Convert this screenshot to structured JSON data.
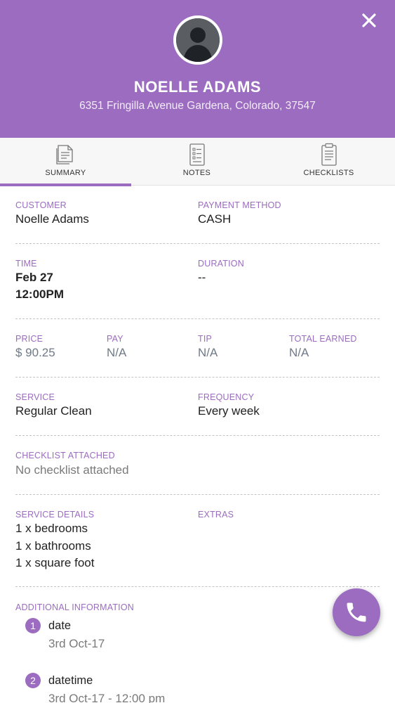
{
  "customer_header": {
    "name": "NOELLE ADAMS",
    "address": "6351 Fringilla Avenue Gardena, Colorado, 37547",
    "close_icon": "close-icon",
    "avatar_icon": "person-silhouette-icon"
  },
  "tabs": [
    {
      "label": "SUMMARY",
      "icon": "document-icon",
      "active": true
    },
    {
      "label": "NOTES",
      "icon": "notes-icon",
      "active": false
    },
    {
      "label": "CHECKLISTS",
      "icon": "clipboard-icon",
      "active": false
    }
  ],
  "summary": {
    "customer": {
      "label": "CUSTOMER",
      "value": "Noelle Adams"
    },
    "payment_method": {
      "label": "PAYMENT METHOD",
      "value": "CASH"
    },
    "time": {
      "label": "TIME",
      "date": "Feb 27",
      "time": "12:00PM"
    },
    "duration": {
      "label": "DURATION",
      "value": "--"
    },
    "price": {
      "label": "PRICE",
      "value": "$ 90.25"
    },
    "pay": {
      "label": "PAY",
      "value": "N/A"
    },
    "tip": {
      "label": "TIP",
      "value": "N/A"
    },
    "total_earned": {
      "label": "TOTAL EARNED",
      "value": "N/A"
    },
    "service": {
      "label": "SERVICE",
      "value": "Regular Clean"
    },
    "frequency": {
      "label": "FREQUENCY",
      "value": "Every week"
    },
    "checklist_attached": {
      "label": "CHECKLIST ATTACHED",
      "value": "No checklist attached"
    },
    "service_details": {
      "label": "SERVICE DETAILS",
      "items": [
        "1 x bedrooms",
        "1 x bathrooms",
        "1 x square foot"
      ]
    },
    "extras": {
      "label": "EXTRAS"
    },
    "additional_information": {
      "label": "ADDITIONAL INFORMATION",
      "items": [
        {
          "number": "1",
          "title": "date",
          "value": "3rd Oct-17"
        },
        {
          "number": "2",
          "title": "datetime",
          "value": "3rd Oct-17 - 12:00 pm"
        }
      ]
    }
  },
  "fab": {
    "icon": "phone-icon"
  },
  "colors": {
    "accent": "#9b6cc0",
    "price_text": "#6f7a87",
    "muted_text": "#7a7a7a"
  }
}
